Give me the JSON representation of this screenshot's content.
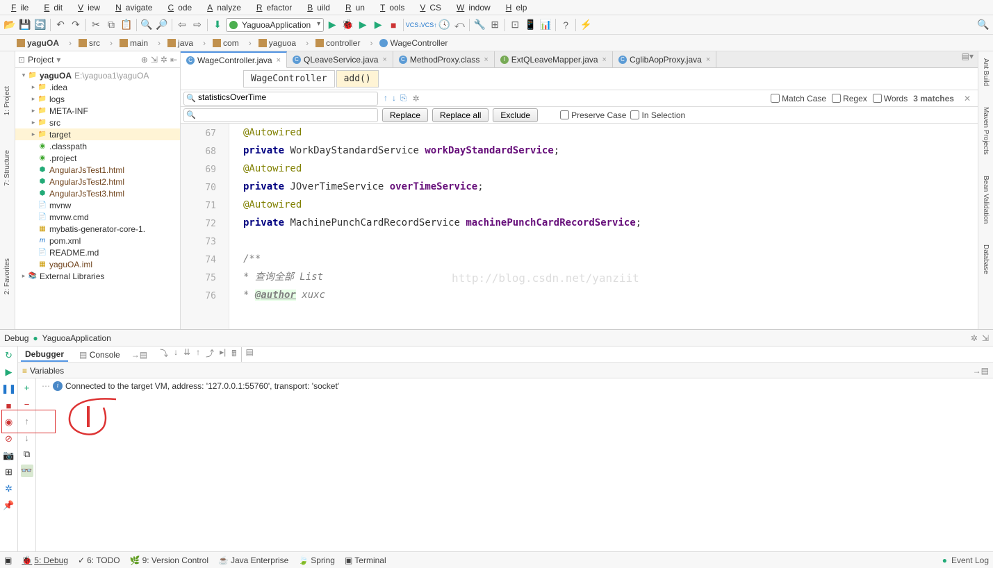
{
  "menu": [
    "File",
    "Edit",
    "View",
    "Navigate",
    "Code",
    "Analyze",
    "Refactor",
    "Build",
    "Run",
    "Tools",
    "VCS",
    "Window",
    "Help"
  ],
  "runConfig": "YaguoaApplication",
  "breadcrumbs": [
    "yaguOA",
    "src",
    "main",
    "java",
    "com",
    "yaguoa",
    "controller",
    "WageController"
  ],
  "project": {
    "header": "Project",
    "root": {
      "label": "yaguOA",
      "path": "E:\\yaguoa1\\yaguOA"
    },
    "children": [
      {
        "label": ".idea",
        "icon": "folder",
        "exp": "+"
      },
      {
        "label": "logs",
        "icon": "folder",
        "exp": "+"
      },
      {
        "label": "META-INF",
        "icon": "folder",
        "exp": "+"
      },
      {
        "label": "src",
        "icon": "folder",
        "exp": "+"
      },
      {
        "label": "target",
        "icon": "folder",
        "exp": "+",
        "sel": true
      },
      {
        "label": ".classpath",
        "icon": "eclipse"
      },
      {
        "label": ".project",
        "icon": "eclipse"
      },
      {
        "label": "AngularJsTest1.html",
        "icon": "html",
        "brown": true
      },
      {
        "label": "AngularJsTest2.html",
        "icon": "html",
        "brown": true
      },
      {
        "label": "AngularJsTest3.html",
        "icon": "html",
        "brown": true
      },
      {
        "label": "mvnw",
        "icon": "file"
      },
      {
        "label": "mvnw.cmd",
        "icon": "file"
      },
      {
        "label": "mybatis-generator-core-1.",
        "icon": "jar"
      },
      {
        "label": "pom.xml",
        "icon": "maven"
      },
      {
        "label": "README.md",
        "icon": "md"
      },
      {
        "label": "yaguOA.iml",
        "icon": "iml",
        "brown": true
      }
    ],
    "ext": "External Libraries"
  },
  "tabs": [
    {
      "label": "WageController.java",
      "icon": "C",
      "active": true
    },
    {
      "label": "QLeaveService.java",
      "icon": "C"
    },
    {
      "label": "MethodProxy.class",
      "icon": "Cb"
    },
    {
      "label": "ExtQLeaveMapper.java",
      "icon": "I"
    },
    {
      "label": "CglibAopProxy.java",
      "icon": "Cb"
    }
  ],
  "editorCrumbs": [
    "WageController",
    "add()"
  ],
  "find": {
    "query": "statisticsOverTime",
    "matches": "3 matches",
    "matchCase": "Match Case",
    "regex": "Regex",
    "words": "Words",
    "replace": "Replace",
    "replaceAll": "Replace all",
    "exclude": "Exclude",
    "preserve": "Preserve Case",
    "inSel": "In Selection"
  },
  "gutter": [
    67,
    68,
    69,
    70,
    71,
    72,
    73,
    74,
    75,
    76
  ],
  "code": {
    "l67": {
      "ann": "@Autowired"
    },
    "l68": {
      "kw": "private",
      "type": "WorkDayStandardService",
      "fld": "workDayStandardService"
    },
    "l69": {
      "ann": "@Autowired"
    },
    "l70": {
      "kw": "private",
      "type": "JOverTimeService",
      "fld": "overTimeService"
    },
    "l71": {
      "ann": "@Autowired"
    },
    "l72": {
      "kw": "private",
      "type": "MachinePunchCardRecordService",
      "fld": "machinePunchCardRecordService"
    },
    "l74": "/**",
    "l75": " * 查询全部 List",
    "l76a": " * ",
    "l76b": "@author",
    "l76c": " xuxc",
    "watermark": "http://blog.csdn.net/yanziit"
  },
  "debug": {
    "title": "Debug",
    "app": "YaguoaApplication",
    "tabs": {
      "debugger": "Debugger",
      "console": "Console"
    },
    "varHeader": "Variables",
    "msg": "Connected to the target VM, address: '127.0.0.1:55760', transport: 'socket'"
  },
  "status": {
    "debug": "5: Debug",
    "todo": "6: TODO",
    "vcs": "9: Version Control",
    "je": "Java Enterprise",
    "spring": "Spring",
    "term": "Terminal",
    "eventlog": "Event Log"
  },
  "rightTools": [
    "Ant Build",
    "Maven Projects",
    "",
    "Bean Validation",
    "Database"
  ],
  "leftTools": [
    "1: Project",
    "7: Structure",
    "2: Favorites"
  ]
}
